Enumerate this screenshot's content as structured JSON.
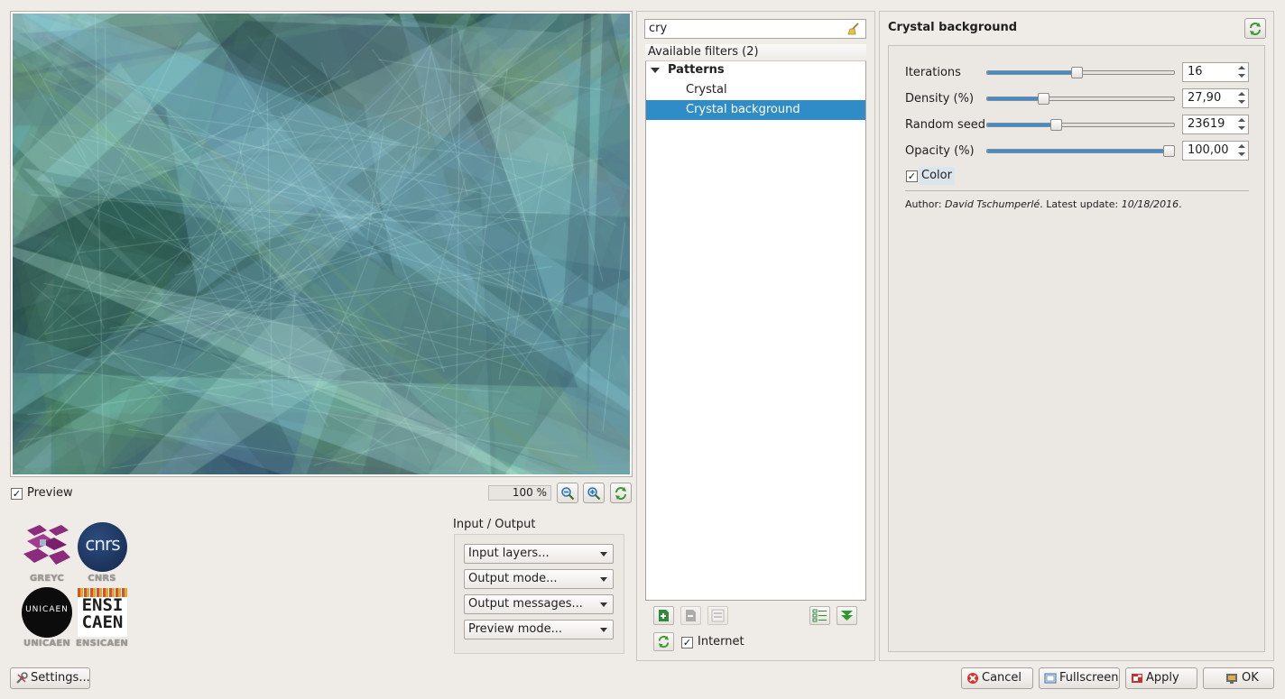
{
  "preview": {
    "checkbox_label": "Preview",
    "checked": true,
    "zoom": "100 %"
  },
  "logos": [
    {
      "name": "GREYC"
    },
    {
      "name": "CNRS",
      "mark": "cnrs"
    },
    {
      "name": "UNICAEN",
      "mark": "UNICAEN"
    },
    {
      "name": "ENSICAEN",
      "mark_top": "ENSI",
      "mark_bottom": "CAEN"
    }
  ],
  "io": {
    "title": "Input / Output",
    "combos": [
      {
        "label": "Input layers..."
      },
      {
        "label": "Output mode..."
      },
      {
        "label": "Output messages..."
      },
      {
        "label": "Preview mode..."
      }
    ]
  },
  "settings_button": "Settings...",
  "filters": {
    "search_value": "cry",
    "header": "Available filters (2)",
    "category": "Patterns",
    "items": [
      {
        "label": "Crystal",
        "selected": false
      },
      {
        "label": "Crystal background",
        "selected": true
      }
    ],
    "internet_label": "Internet",
    "internet_checked": true
  },
  "filter": {
    "title": "Crystal background",
    "params": [
      {
        "label": "Iterations",
        "value": "16",
        "level": 0.48
      },
      {
        "label": "Density (%)",
        "value": "27,90",
        "level": 0.29
      },
      {
        "label": "Random seed",
        "value": "23619",
        "level": 0.36
      },
      {
        "label": "Opacity (%)",
        "value": "100,00",
        "level": 1.0
      }
    ],
    "color_label": "Color",
    "color_checked": true,
    "author_prefix": "Author: ",
    "author_name": "David Tschumperlé",
    "update_prefix": ". Latest update: ",
    "update_date": "10/18/2016",
    "update_suffix": "."
  },
  "buttons": {
    "cancel": "Cancel",
    "fullscreen": "Fullscreen",
    "apply": "Apply",
    "ok": "OK"
  },
  "colors": {
    "selection": "#308cc6",
    "slider_fill": "#3a8ed4",
    "window_bg": "#efebe7"
  }
}
